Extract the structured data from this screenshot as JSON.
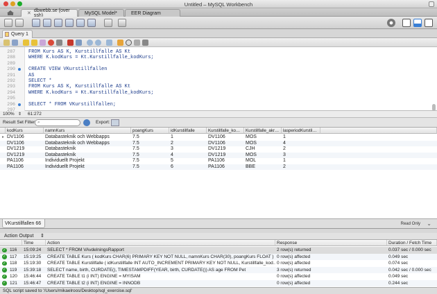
{
  "window": {
    "title": "Untitled – MySQL Workbench"
  },
  "doc_tabs": [
    {
      "label": "dbwebb.se (over ssh)"
    },
    {
      "label": "MySQL Model*"
    },
    {
      "label": "EER Diagram"
    }
  ],
  "query_tab": {
    "label": "Query 1"
  },
  "editor": {
    "lines": [
      {
        "num": "287",
        "code": "FROM Kurs AS K, Kurstillfalle AS Kt",
        "bullet": false
      },
      {
        "num": "288",
        "code": "WHERE K.kodKurs = Kt.Kurstillfalle_kodKurs;",
        "bullet": false
      },
      {
        "num": "289",
        "code": "",
        "bullet": false
      },
      {
        "num": "290",
        "code": "CREATE VIEW VKurstillfallen",
        "bullet": true
      },
      {
        "num": "291",
        "code": "AS",
        "bullet": false
      },
      {
        "num": "292",
        "code": "SELECT *",
        "bullet": false
      },
      {
        "num": "293",
        "code": "FROM Kurs AS K, Kurstillfalle AS Kt",
        "bullet": false
      },
      {
        "num": "294",
        "code": "WHERE K.kodKurs = Kt.Kurstillfalle_kodKurs;",
        "bullet": false
      },
      {
        "num": "295",
        "code": "",
        "bullet": false
      },
      {
        "num": "296",
        "code": "SELECT * FROM VKurstillfallen;",
        "bullet": true
      },
      {
        "num": "297",
        "code": "",
        "bullet": false
      }
    ]
  },
  "status": {
    "zoom": "100%",
    "position": "61:272"
  },
  "result_toolbar": {
    "filter_label": "Result Set Filter:",
    "export_label": "Export:"
  },
  "grid": {
    "columns": [
      "kodKurs",
      "namnKurs",
      "poangKurs",
      "idKurstillfalle",
      "Kurstillfalle_ko…",
      "Kurstillfalle_akr…",
      "lasperiodKurstil…"
    ],
    "rows": [
      [
        "DV1106",
        "Databasteknik och Webbapps",
        "7.5",
        "1",
        "DV1106",
        "MOS",
        "1"
      ],
      [
        "DV1106",
        "Databasteknik och Webbapps",
        "7.5",
        "2",
        "DV1106",
        "MOS",
        "4"
      ],
      [
        "DV1219",
        "Databasteknik",
        "7.5",
        "3",
        "DV1219",
        "CJH",
        "2"
      ],
      [
        "DV1219",
        "Databasteknik",
        "7.5",
        "4",
        "DV1219",
        "MOS",
        "3"
      ],
      [
        "PA1106",
        "Individuellt Projekt",
        "7.5",
        "5",
        "PA1106",
        "MOL",
        "1"
      ],
      [
        "PA1106",
        "Individuellt Projekt",
        "7.5",
        "6",
        "PA1106",
        "BBE",
        "2"
      ]
    ]
  },
  "result_tab": {
    "label": "VKurstillfallen 66"
  },
  "read_only": "Read Only",
  "action_output": {
    "title": "Action Output",
    "columns": [
      "Time",
      "Action",
      "Response",
      "Duration / Fetch Time"
    ],
    "rows": [
      {
        "num": "116",
        "time": "15:09:24",
        "action": "SELECT * FROM VAvdelningsRapport",
        "response": "2 row(s) returned",
        "duration": "0.037 sec / 0.000 sec"
      },
      {
        "num": "117",
        "time": "15:19:25",
        "action": "CREATE TABLE Kurs (   kodKurs CHAR(6) PRIMARY KEY NOT NULL,   namnKurs CHAR(30),   poangKurs FLOAT )",
        "response": "0 row(s) affected",
        "duration": "0.049 sec"
      },
      {
        "num": "118",
        "time": "15:19:30",
        "action": "CREATE TABLE Kurstillfalle (   idKurstillfalle INT AUTO_INCREMENT PRIMARY KEY NOT NULL,   Kurstillfalle_kod…",
        "response": "0 row(s) affected",
        "duration": "0.074 sec"
      },
      {
        "num": "119",
        "time": "15:39:18",
        "action": "SELECT   name, birth, CURDATE(),   TIMESTAMPDIFF(YEAR, birth, CURDATE()) AS age FROM Pet",
        "response": "3 row(s) returned",
        "duration": "0.042 sec / 0.000 sec"
      },
      {
        "num": "120",
        "time": "15:46:44",
        "action": "CREATE TABLE t1 (i INT) ENGINE = MYISAM",
        "response": "0 row(s) affected",
        "duration": "0.049 sec"
      },
      {
        "num": "121",
        "time": "15:46:47",
        "action": "CREATE TABLE t2 (i INT) ENGINE = INNODB",
        "response": "0 row(s) affected",
        "duration": "0.244 sec"
      }
    ]
  },
  "footer": {
    "message": "SQL script saved to '/Users/mikaelroos/Desktop/sql_exercise.sql'"
  },
  "colors": {
    "accent": "#3a7fd5",
    "ok": "#2e9a2e",
    "close": "#e0443e",
    "minimize": "#dea123",
    "zoom": "#1aab29"
  }
}
